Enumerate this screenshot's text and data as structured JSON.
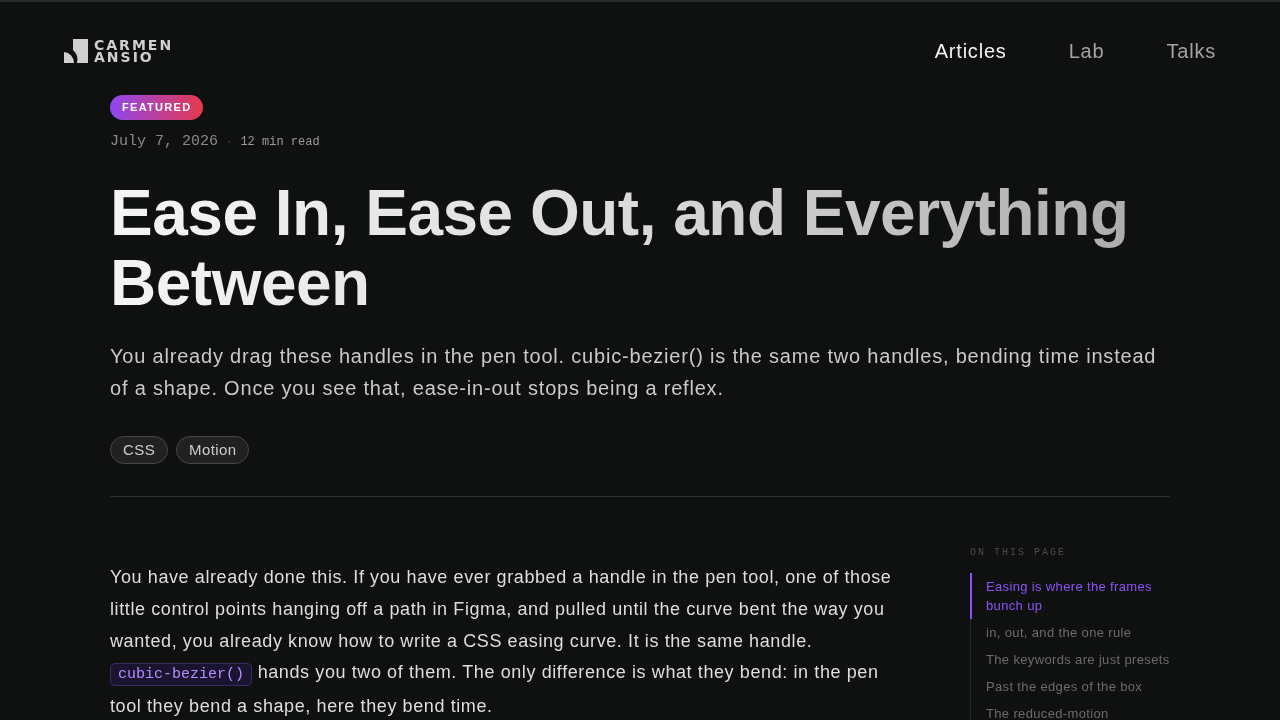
{
  "header": {
    "logo": {
      "line_1": "CARMEN",
      "line_2": "ANSIO"
    },
    "nav": [
      {
        "label": "Articles",
        "selected": true
      },
      {
        "label": "Lab",
        "selected": false
      },
      {
        "label": "Talks",
        "selected": false
      }
    ]
  },
  "article": {
    "badge": "FEATURED",
    "date": "July 7, 2026",
    "separator": "·",
    "reading_time": "12 min read",
    "title": "Ease In, Ease Out, and Everything Between",
    "lead": "You already drag these handles in the pen tool. cubic-bezier() is the same two handles, bending time instead of a shape. Once you see that, ease-in-out stops being a reflex.",
    "tags": [
      "CSS",
      "Motion"
    ],
    "body": [
      {
        "kind": "paragraph",
        "segments": [
          {
            "kind": "text",
            "text": "You have already done this. If you have ever grabbed a handle in the pen tool, one of those little control points hanging off a path in Figma, and pulled until the curve bent the way you wanted, you already know how to write a CSS easing curve. It is the same handle. "
          },
          {
            "kind": "code",
            "text": "cubic-bezier()"
          },
          {
            "kind": "text",
            "text": " hands you two of them. The only difference is what they bend: in the pen tool they bend a shape, here they bend time."
          }
        ]
      }
    ]
  },
  "toc": {
    "heading": "ON THIS PAGE",
    "items": [
      {
        "label": "Easing is where the frames bunch up",
        "selected": true
      },
      {
        "label": "in, out, and the one rule",
        "selected": false
      },
      {
        "label": "The keywords are just presets",
        "selected": false
      },
      {
        "label": "Past the edges of the box",
        "selected": false
      },
      {
        "label": "The reduced-motion",
        "selected": false
      }
    ]
  }
}
